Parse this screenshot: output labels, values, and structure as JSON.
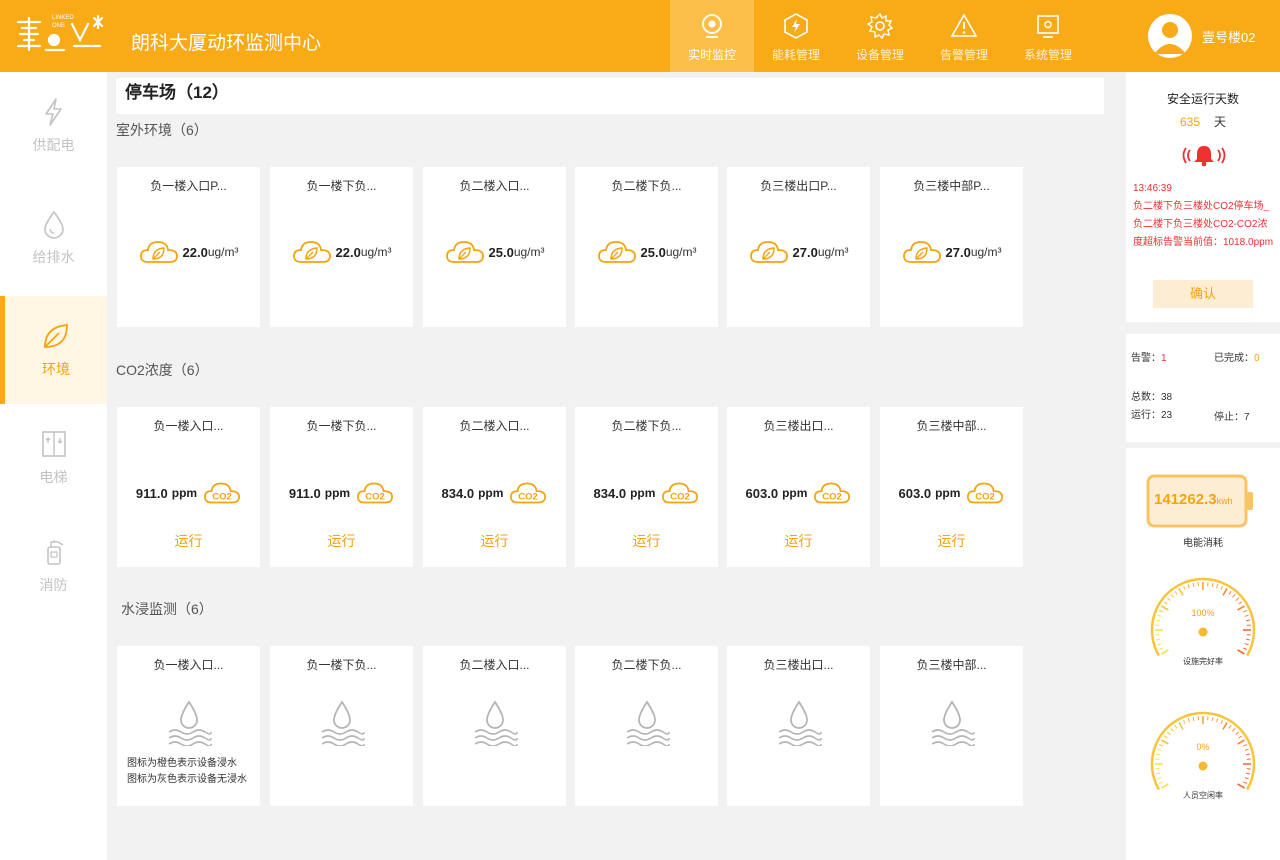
{
  "header": {
    "app_title": "朗科大厦动环监测中心",
    "nav": [
      {
        "label": "实时监控",
        "icon": "monitor-icon",
        "active": true
      },
      {
        "label": "能耗管理",
        "icon": "energy-icon",
        "active": false
      },
      {
        "label": "设备管理",
        "icon": "gear-icon",
        "active": false
      },
      {
        "label": "告警管理",
        "icon": "warning-icon",
        "active": false
      },
      {
        "label": "系统管理",
        "icon": "system-icon",
        "active": false
      }
    ],
    "user_name": "壹号楼02"
  },
  "sidebar": {
    "items": [
      {
        "label": "供配电",
        "icon": "lightning-icon"
      },
      {
        "label": "给排水",
        "icon": "water-drop-icon"
      },
      {
        "label": "环境",
        "icon": "leaf-icon",
        "active": true
      },
      {
        "label": "电梯",
        "icon": "elevator-icon"
      },
      {
        "label": "消防",
        "icon": "fire-extinguisher-icon"
      }
    ]
  },
  "main": {
    "page_title": "停车场（12）",
    "outdoor": {
      "title": "室外环境（6）",
      "cards": [
        {
          "name": "负一楼入口P...",
          "value": "22.0",
          "unit": "ug/m³"
        },
        {
          "name": "负一楼下负...",
          "value": "22.0",
          "unit": "ug/m³"
        },
        {
          "name": "负二楼入口...",
          "value": "25.0",
          "unit": "ug/m³"
        },
        {
          "name": "负二楼下负...",
          "value": "25.0",
          "unit": "ug/m³"
        },
        {
          "name": "负三楼出口P...",
          "value": "27.0",
          "unit": "ug/m³"
        },
        {
          "name": "负三楼中部P...",
          "value": "27.0",
          "unit": " ug/m³"
        }
      ]
    },
    "co2": {
      "title": "CO2浓度（6）",
      "cards": [
        {
          "name": "负一楼入口...",
          "value": "911.0",
          "unit": "ppm",
          "status": "运行"
        },
        {
          "name": "负一楼下负...",
          "value": "911.0",
          "unit": "ppm",
          "status": "运行"
        },
        {
          "name": "负二楼入口...",
          "value": "834.0",
          "unit": "ppm",
          "status": "运行"
        },
        {
          "name": "负二楼下负...",
          "value": "834.0",
          "unit": "ppm",
          "status": "运行"
        },
        {
          "name": "负三楼出口...",
          "value": "603.0",
          "unit": "ppm",
          "status": "运行"
        },
        {
          "name": "负三楼中部...",
          "value": "603.0",
          "unit": "ppm",
          "status": "运行"
        }
      ]
    },
    "water": {
      "title": "水浸监测（6）",
      "cards": [
        {
          "name": "负一楼入口..."
        },
        {
          "name": "负一楼下负..."
        },
        {
          "name": "负二楼入口..."
        },
        {
          "name": "负二楼下负..."
        },
        {
          "name": "负三楼出口..."
        },
        {
          "name": "负三楼中部..."
        }
      ],
      "legend_1": "图标为橙色表示设备浸水",
      "legend_2": "图标为灰色表示设备无浸水"
    }
  },
  "right_panel": {
    "safe_title": "安全运行天数",
    "safe_days": "635",
    "safe_unit": "天",
    "alarm_time": "13:46:39",
    "alarm_message": "负二楼下负三楼处CO2停车场_负二楼下负三楼处CO2-CO2浓度超标告警当前值：1018.0ppm",
    "confirm_label": "确认",
    "stats": {
      "alarm_label": "告警：",
      "alarm_value": "1",
      "done_label": "已完成：",
      "done_value": "0",
      "total_label": "总数：",
      "total_value": "38",
      "running_label": "运行：",
      "running_value": "23",
      "stopped_label": "停止：",
      "stopped_value": "7"
    },
    "energy_value": "141262.3",
    "energy_unit": "kwh",
    "energy_label": "电能消耗",
    "gauge1": {
      "value": "100%",
      "label": "设施完好率",
      "fraction": 1.0
    },
    "gauge2": {
      "value": "0%",
      "label": "人员空闲率",
      "fraction": 0.0
    }
  },
  "colors": {
    "accent": "#f8ab16",
    "alarm": "#ee3030",
    "muted": "#c3c3c3"
  }
}
